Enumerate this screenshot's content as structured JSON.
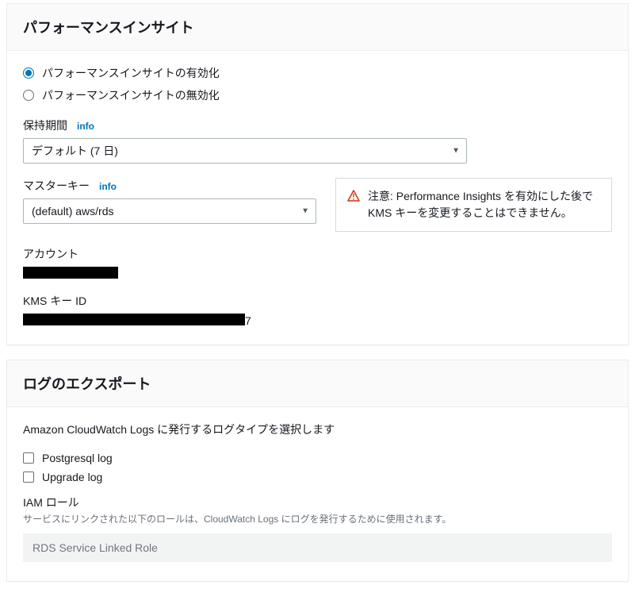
{
  "perf": {
    "title": "パフォーマンスインサイト",
    "radios": {
      "enable": "パフォーマンスインサイトの有効化",
      "disable": "パフォーマンスインサイトの無効化"
    },
    "retention": {
      "label": "保持期間",
      "info": "info",
      "value": "デフォルト (7 日)"
    },
    "masterKey": {
      "label": "マスターキー",
      "info": "info",
      "value": "(default) aws/rds"
    },
    "warning": "注意: Performance Insights を有効にした後で KMS キーを変更することはできません。",
    "account": {
      "label": "アカウント"
    },
    "kmsKeyId": {
      "label": "KMS キー ID",
      "trail": "7"
    }
  },
  "logs": {
    "title": "ログのエクスポート",
    "description": "Amazon CloudWatch Logs に発行するログタイプを選択します",
    "options": {
      "postgresql": "Postgresql log",
      "upgrade": "Upgrade log"
    },
    "iamRole": {
      "label": "IAM ロール",
      "helper": "サービスにリンクされた以下のロールは、CloudWatch Logs にログを発行するために使用されます。",
      "value": "RDS Service Linked Role"
    }
  }
}
